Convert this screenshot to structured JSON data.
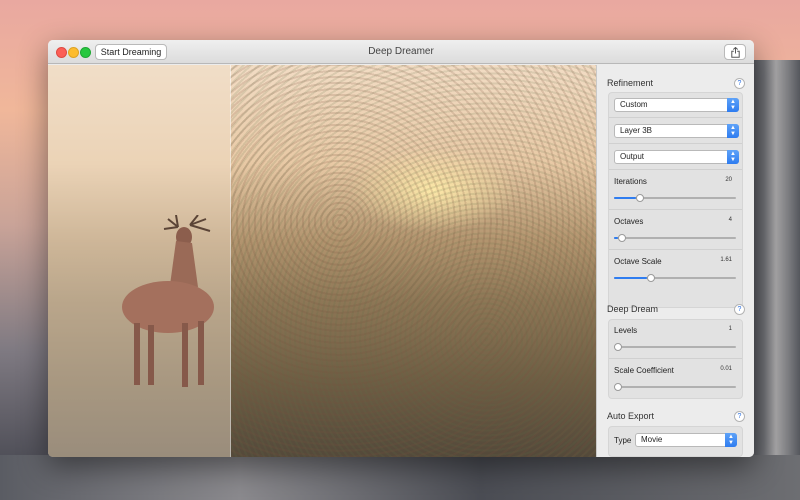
{
  "window": {
    "title": "Deep Dreamer",
    "start_button": "Start Dreaming"
  },
  "icons": {
    "share": "share-icon",
    "help": "help-icon"
  },
  "colors": {
    "accent": "#2f7df0",
    "close": "#fc5f57",
    "minimize": "#fdbc2e",
    "zoom": "#28c840"
  },
  "panel": {
    "refinement": {
      "header": "Refinement",
      "help": "?",
      "selects": [
        {
          "value": "Custom"
        },
        {
          "value": "Layer 3B"
        },
        {
          "value": "Output"
        }
      ],
      "sliders": [
        {
          "label": "Iterations",
          "value": "20",
          "fraction": 0.18
        },
        {
          "label": "Octaves",
          "value": "4",
          "fraction": 0.03
        },
        {
          "label": "Octave Scale",
          "value": "1.61",
          "fraction": 0.27
        }
      ]
    },
    "deep_dream": {
      "header": "Deep Dream",
      "help": "?",
      "sliders": [
        {
          "label": "Levels",
          "value": "1",
          "fraction": 0.0
        },
        {
          "label": "Scale Coefficient",
          "value": "0.01",
          "fraction": 0.0
        }
      ]
    },
    "auto_export": {
      "header": "Auto Export",
      "help": "?",
      "type_label": "Type",
      "type_value": "Movie"
    }
  }
}
